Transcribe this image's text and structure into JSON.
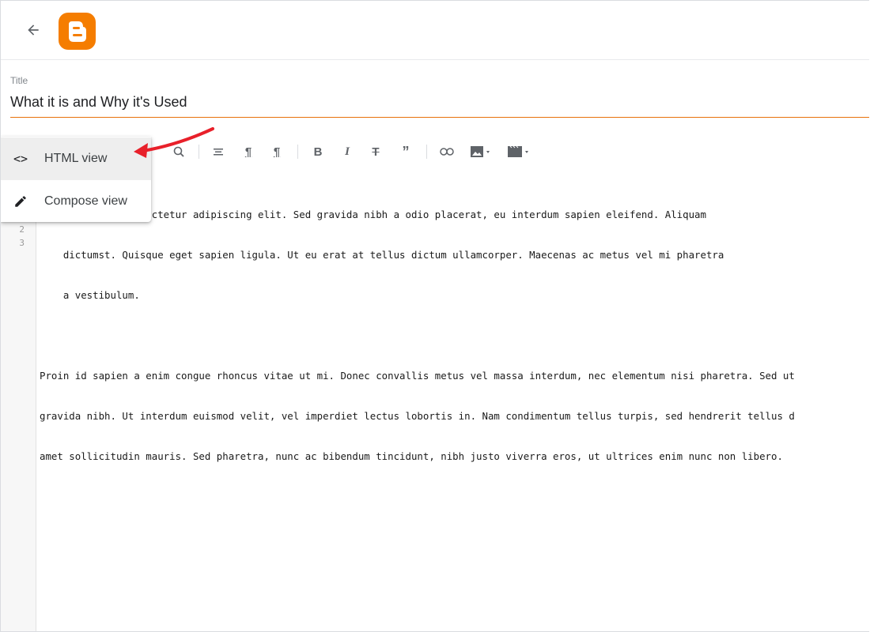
{
  "header": {
    "back_icon": "arrow-left-icon",
    "logo_icon": "blogger-logo-icon",
    "accent_color": "#f57d00"
  },
  "post": {
    "title_label": "Title",
    "title_value": "What it is and Why it's Used"
  },
  "view_menu": {
    "items": [
      {
        "label": "HTML view",
        "icon": "code-icon",
        "active": true
      },
      {
        "label": "Compose view",
        "icon": "pencil-icon",
        "active": false
      }
    ]
  },
  "toolbar": {
    "buttons": [
      {
        "name": "find-replace-icon",
        "glyph": "⌕"
      },
      {
        "name": "align-icon",
        "glyph": "≡"
      },
      {
        "name": "paragraph-ltr-icon",
        "glyph": "¶"
      },
      {
        "name": "paragraph-rtl-icon",
        "glyph": "¶"
      },
      {
        "name": "bold-icon",
        "glyph": "B"
      },
      {
        "name": "italic-icon",
        "glyph": "I"
      },
      {
        "name": "strikethrough-icon",
        "glyph": "S"
      },
      {
        "name": "quote-icon",
        "glyph": "”"
      },
      {
        "name": "link-icon",
        "glyph": "⊂⊃"
      },
      {
        "name": "image-icon",
        "glyph": "▆"
      },
      {
        "name": "video-icon",
        "glyph": "▇"
      }
    ]
  },
  "editor": {
    "line_numbers": [
      "2",
      "3"
    ],
    "lines": [
      "    sit amet, consectetur adipiscing elit. Sed gravida nibh a odio placerat, eu interdum sapien eleifend. Aliquam",
      "    dictumst. Quisque eget sapien ligula. Ut eu erat at tellus dictum ullamcorper. Maecenas ac metus vel mi pharetra",
      "    a vestibulum.",
      "",
      "Proin id sapien a enim congue rhoncus vitae ut mi. Donec convallis metus vel massa interdum, nec elementum nisi pharetra. Sed ut",
      "gravida nibh. Ut interdum euismod velit, vel imperdiet lectus lobortis in. Nam condimentum tellus turpis, sed hendrerit tellus d",
      "amet sollicitudin mauris. Sed pharetra, nunc ac bibendum tincidunt, nibh justo viverra eros, ut ultrices enim nunc non libero."
    ]
  },
  "annotation": {
    "color": "#e8202a"
  }
}
